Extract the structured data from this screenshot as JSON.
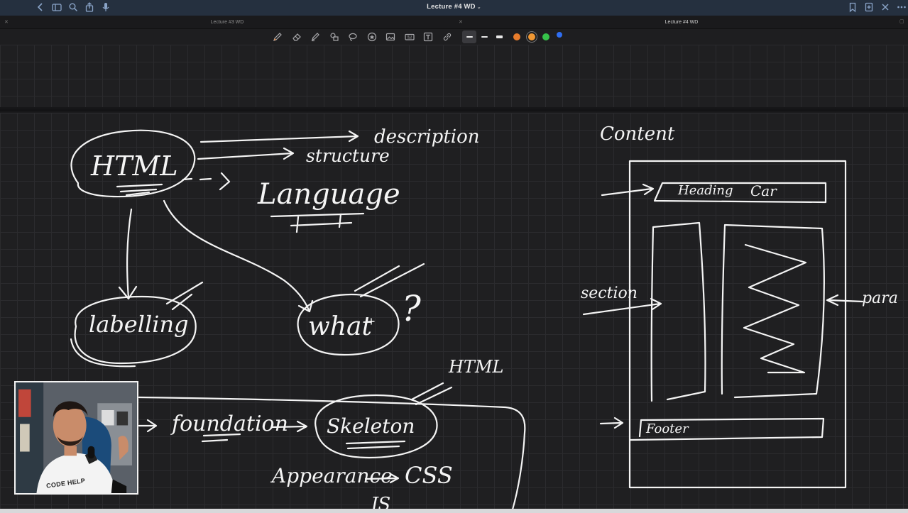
{
  "window": {
    "title": "Lecture #4 WD",
    "left_icons": [
      "chevron-left-icon",
      "sidebar-icon",
      "search-icon",
      "share-icon",
      "microphone-icon"
    ],
    "right_icons": [
      "bookmark-icon",
      "new-page-icon",
      "close-icon",
      "more-icon"
    ]
  },
  "tabs": [
    {
      "label": "Lecture #3 WD",
      "active": false
    },
    {
      "label": "Lecture #4 WD",
      "active": true
    }
  ],
  "toolbar": {
    "tools": [
      "pen-icon",
      "eraser-icon",
      "highlighter-icon",
      "shapes-icon",
      "lasso-icon",
      "sticker-icon",
      "image-icon",
      "keyboard-icon",
      "text-icon",
      "link-icon"
    ],
    "colors": [
      "#e87c2c",
      "#f09733",
      "#36c24a",
      "#2f6ef2"
    ],
    "selected_color": "#f09733"
  },
  "notes": {
    "html": "HTML",
    "description": "description",
    "structure": "structure",
    "language": "Language",
    "labelling": "labelling",
    "what": "what",
    "question": "?",
    "html_small": "HTML",
    "foundation": "foundation",
    "skeleton": "Skeleton",
    "appearance": "Appearance",
    "css": "CSS",
    "js": "JS",
    "content": "Content",
    "heading": "Heading",
    "car": "Car",
    "section": "section",
    "para": "para",
    "footer": "Footer"
  },
  "webcam": {
    "label": "CODE HELP"
  }
}
